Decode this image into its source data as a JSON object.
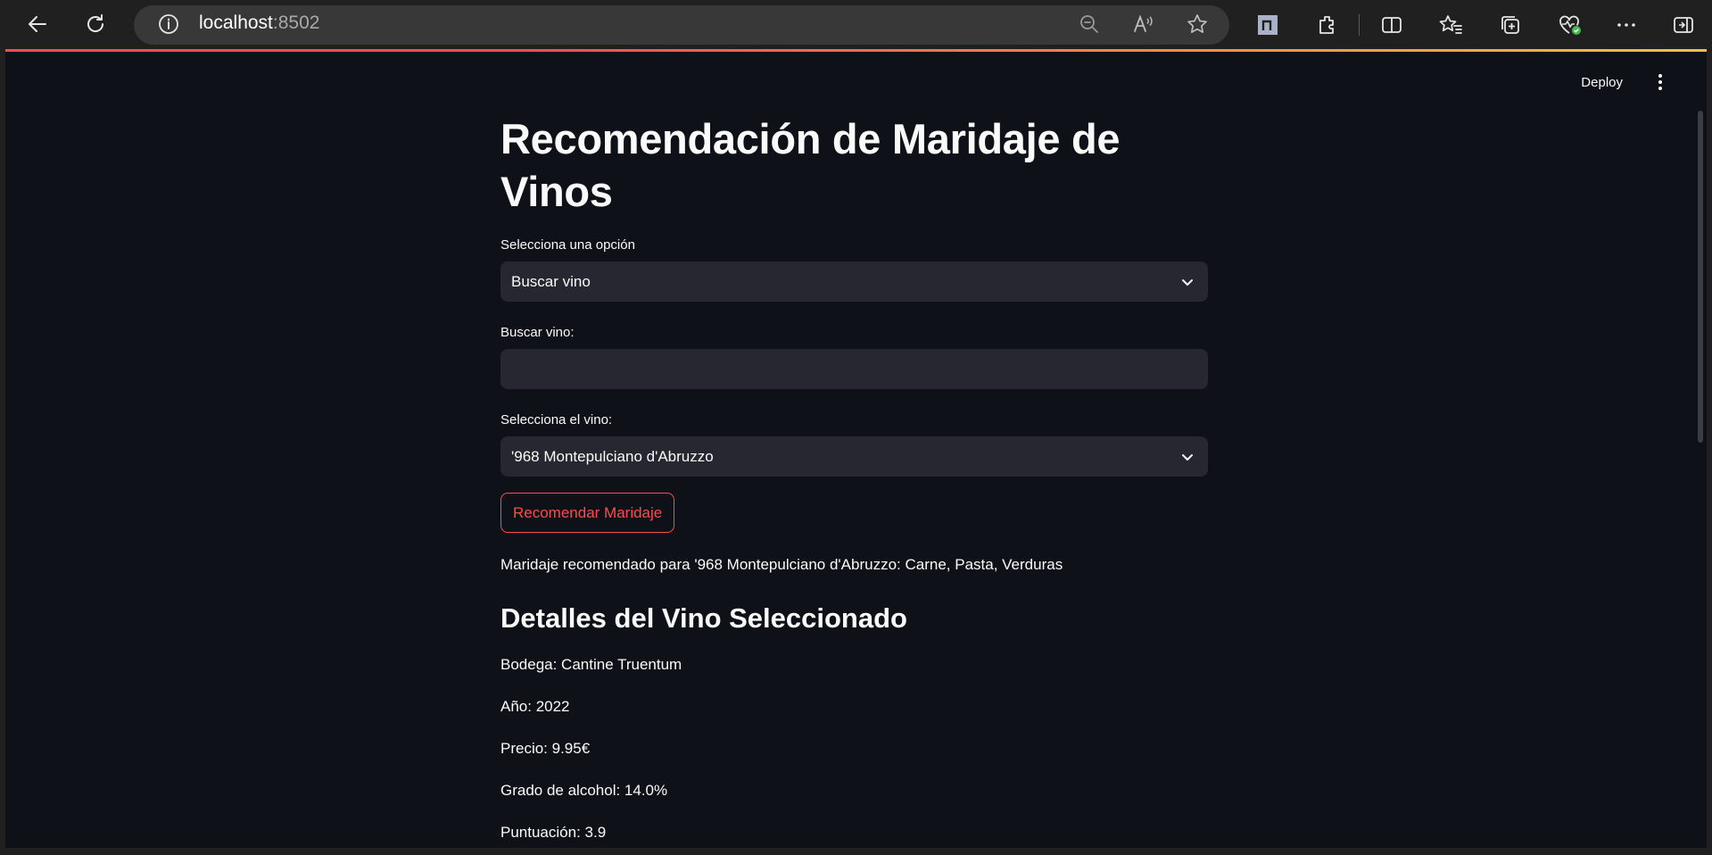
{
  "browser": {
    "url_host": "localhost",
    "url_port": ":8502"
  },
  "header": {
    "deploy_label": "Deploy"
  },
  "main": {
    "title": "Recomendación de Maridaje de Vinos",
    "option_label": "Selecciona una opción",
    "option_value": "Buscar vino",
    "search_label": "Buscar vino:",
    "search_value": "",
    "wine_label": "Selecciona el vino:",
    "wine_value": "'968 Montepulciano d'Abruzzo",
    "recommend_button": "Recomendar Maridaje",
    "result_text": "Maridaje recomendado para '968 Montepulciano d'Abruzzo: Carne, Pasta, Verduras",
    "details_title": "Detalles del Vino Seleccionado",
    "details": [
      "Bodega: Cantine Truentum",
      "Año: 2022",
      "Precio: 9.95€",
      "Grado de alcohol: 14.0%",
      "Puntuación: 3.9"
    ]
  },
  "colors": {
    "background": "#0e1117",
    "field": "#262730",
    "accent": "#ff4b4b"
  }
}
